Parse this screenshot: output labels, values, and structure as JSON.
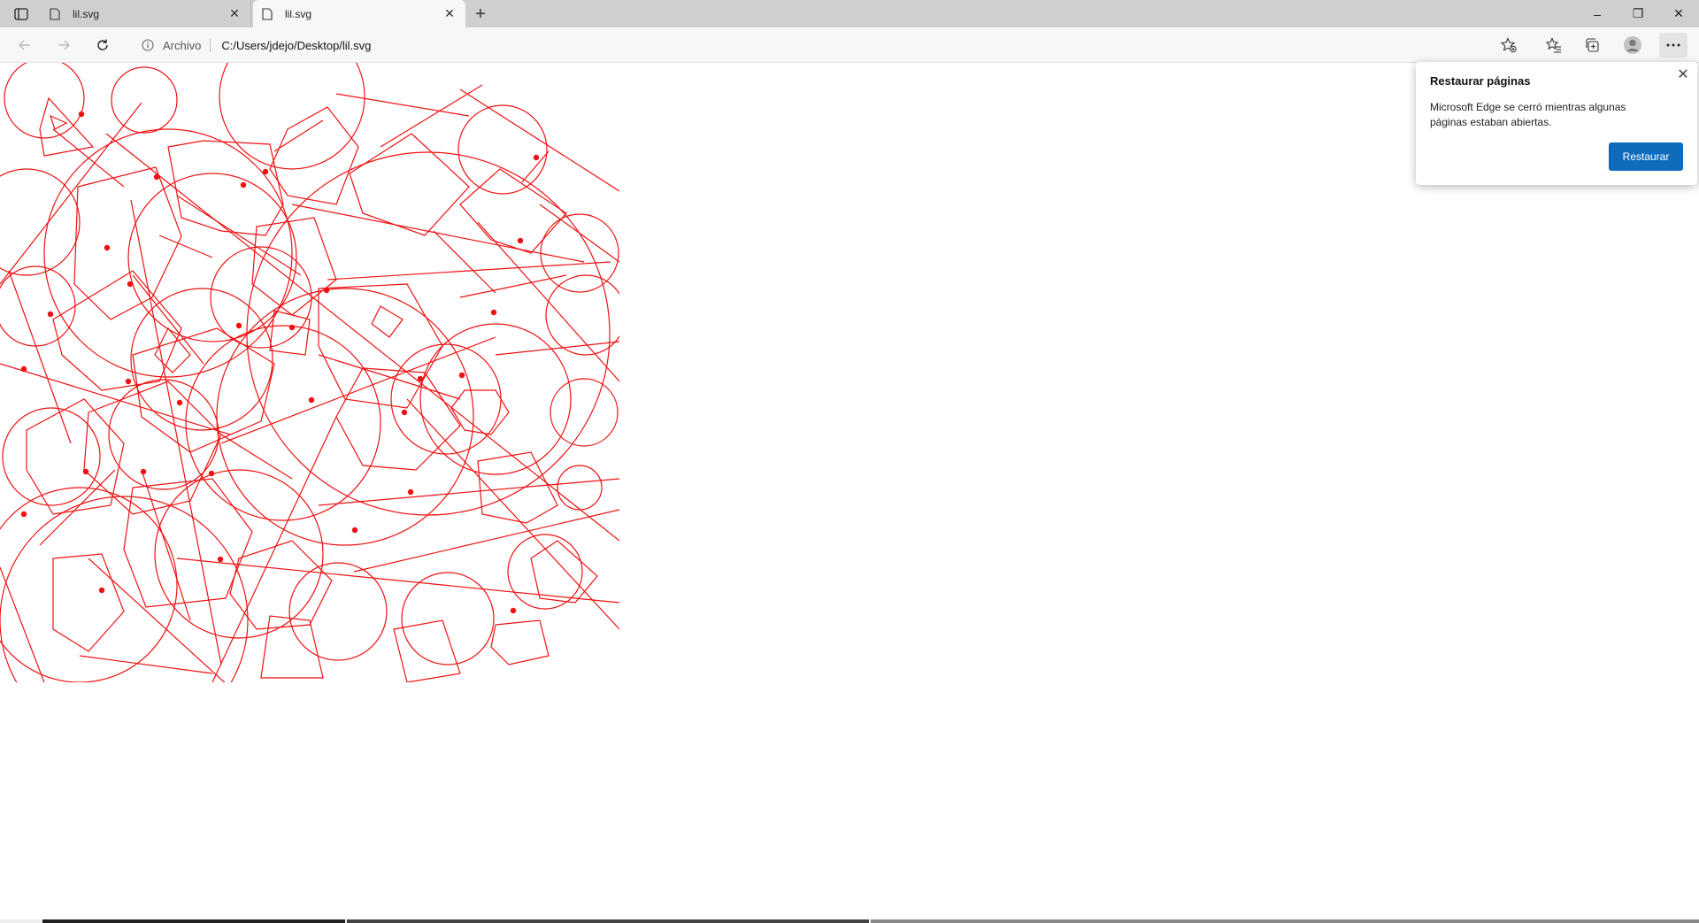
{
  "tabs": [
    {
      "label": "lil.svg",
      "active": false
    },
    {
      "label": "lil.svg",
      "active": true
    }
  ],
  "window_controls": {
    "minimize": "–",
    "restore": "❐",
    "close": "✕"
  },
  "address": {
    "scheme_label": "Archivo",
    "url": "C:/Users/jdejo/Desktop/lil.svg"
  },
  "popup": {
    "title": "Restaurar páginas",
    "message": "Microsoft Edge se cerró mientras algunas páginas estaban abiertas.",
    "button_label": "Restaurar"
  },
  "colors": {
    "stroke": "#ee1111",
    "accent": "#0f6cbd"
  },
  "icons": [
    "tab-actions-icon",
    "page-icon",
    "close-icon",
    "plus-icon",
    "back-arrow-icon",
    "forward-arrow-icon",
    "refresh-icon",
    "info-icon",
    "favorite-add-icon",
    "favorites-icon",
    "collections-icon",
    "profile-icon",
    "more-icon"
  ]
}
